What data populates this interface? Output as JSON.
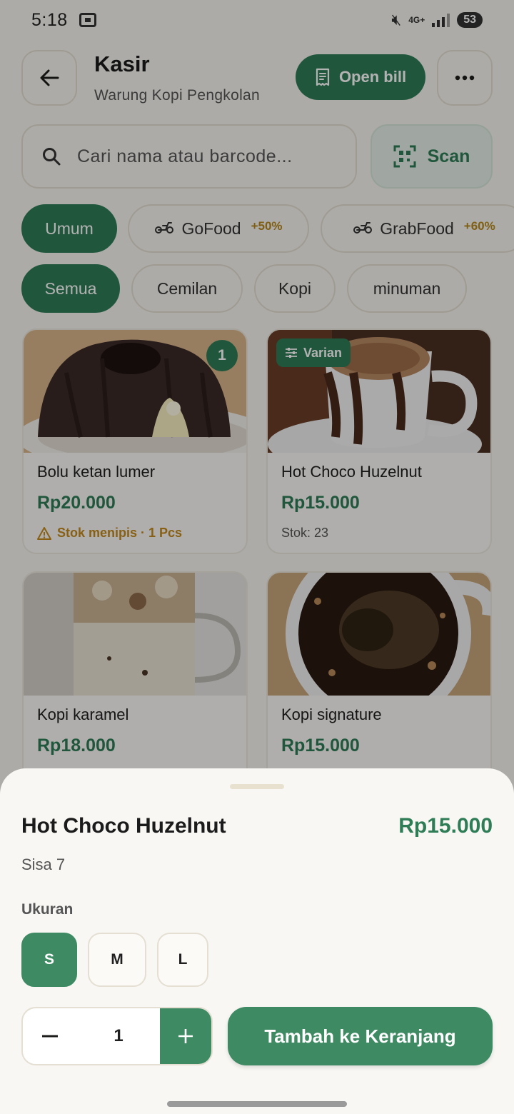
{
  "status_bar": {
    "time": "5:18",
    "network": "4G+",
    "battery": "53"
  },
  "header": {
    "title": "Kasir",
    "subtitle": "Warung Kopi Pengkolan",
    "open_bill_label": "Open bill"
  },
  "search": {
    "placeholder": "Cari nama atau barcode...",
    "scan_label": "Scan"
  },
  "channels": [
    {
      "label": "Umum",
      "active": true
    },
    {
      "label": "GoFood",
      "markup": "+50%"
    },
    {
      "label": "GrabFood",
      "markup": "+60%"
    }
  ],
  "categories": [
    {
      "label": "Semua",
      "active": true
    },
    {
      "label": "Cemilan"
    },
    {
      "label": "Kopi"
    },
    {
      "label": "minuman"
    }
  ],
  "products": [
    {
      "name": "Bolu ketan lumer",
      "price": "Rp20.000",
      "stock": "Stok menipis · 1 Pcs",
      "cart_count": "1",
      "image_icon": "chocolate-cake-image"
    },
    {
      "name": "Hot Choco Huzelnut",
      "price": "Rp15.000",
      "stock": "Stok: 23",
      "variant_label": "Varian",
      "image_icon": "hot-chocolate-image"
    },
    {
      "name": "Kopi karamel",
      "price": "Rp18.000",
      "image_icon": "iced-latte-image"
    },
    {
      "name": "Kopi signature",
      "price": "Rp15.000",
      "image_icon": "black-coffee-image"
    }
  ],
  "sheet": {
    "product_name": "Hot Choco Huzelnut",
    "price": "Rp15.000",
    "remaining": "Sisa 7",
    "size_label": "Ukuran",
    "sizes": [
      {
        "label": "S",
        "selected": true
      },
      {
        "label": "M"
      },
      {
        "label": "L"
      }
    ],
    "quantity": "1",
    "add_to_cart_label": "Tambah ke Keranjang"
  },
  "colors": {
    "primary": "#2f7d57",
    "warning": "#c28a1e",
    "background": "#f7f5ef"
  }
}
